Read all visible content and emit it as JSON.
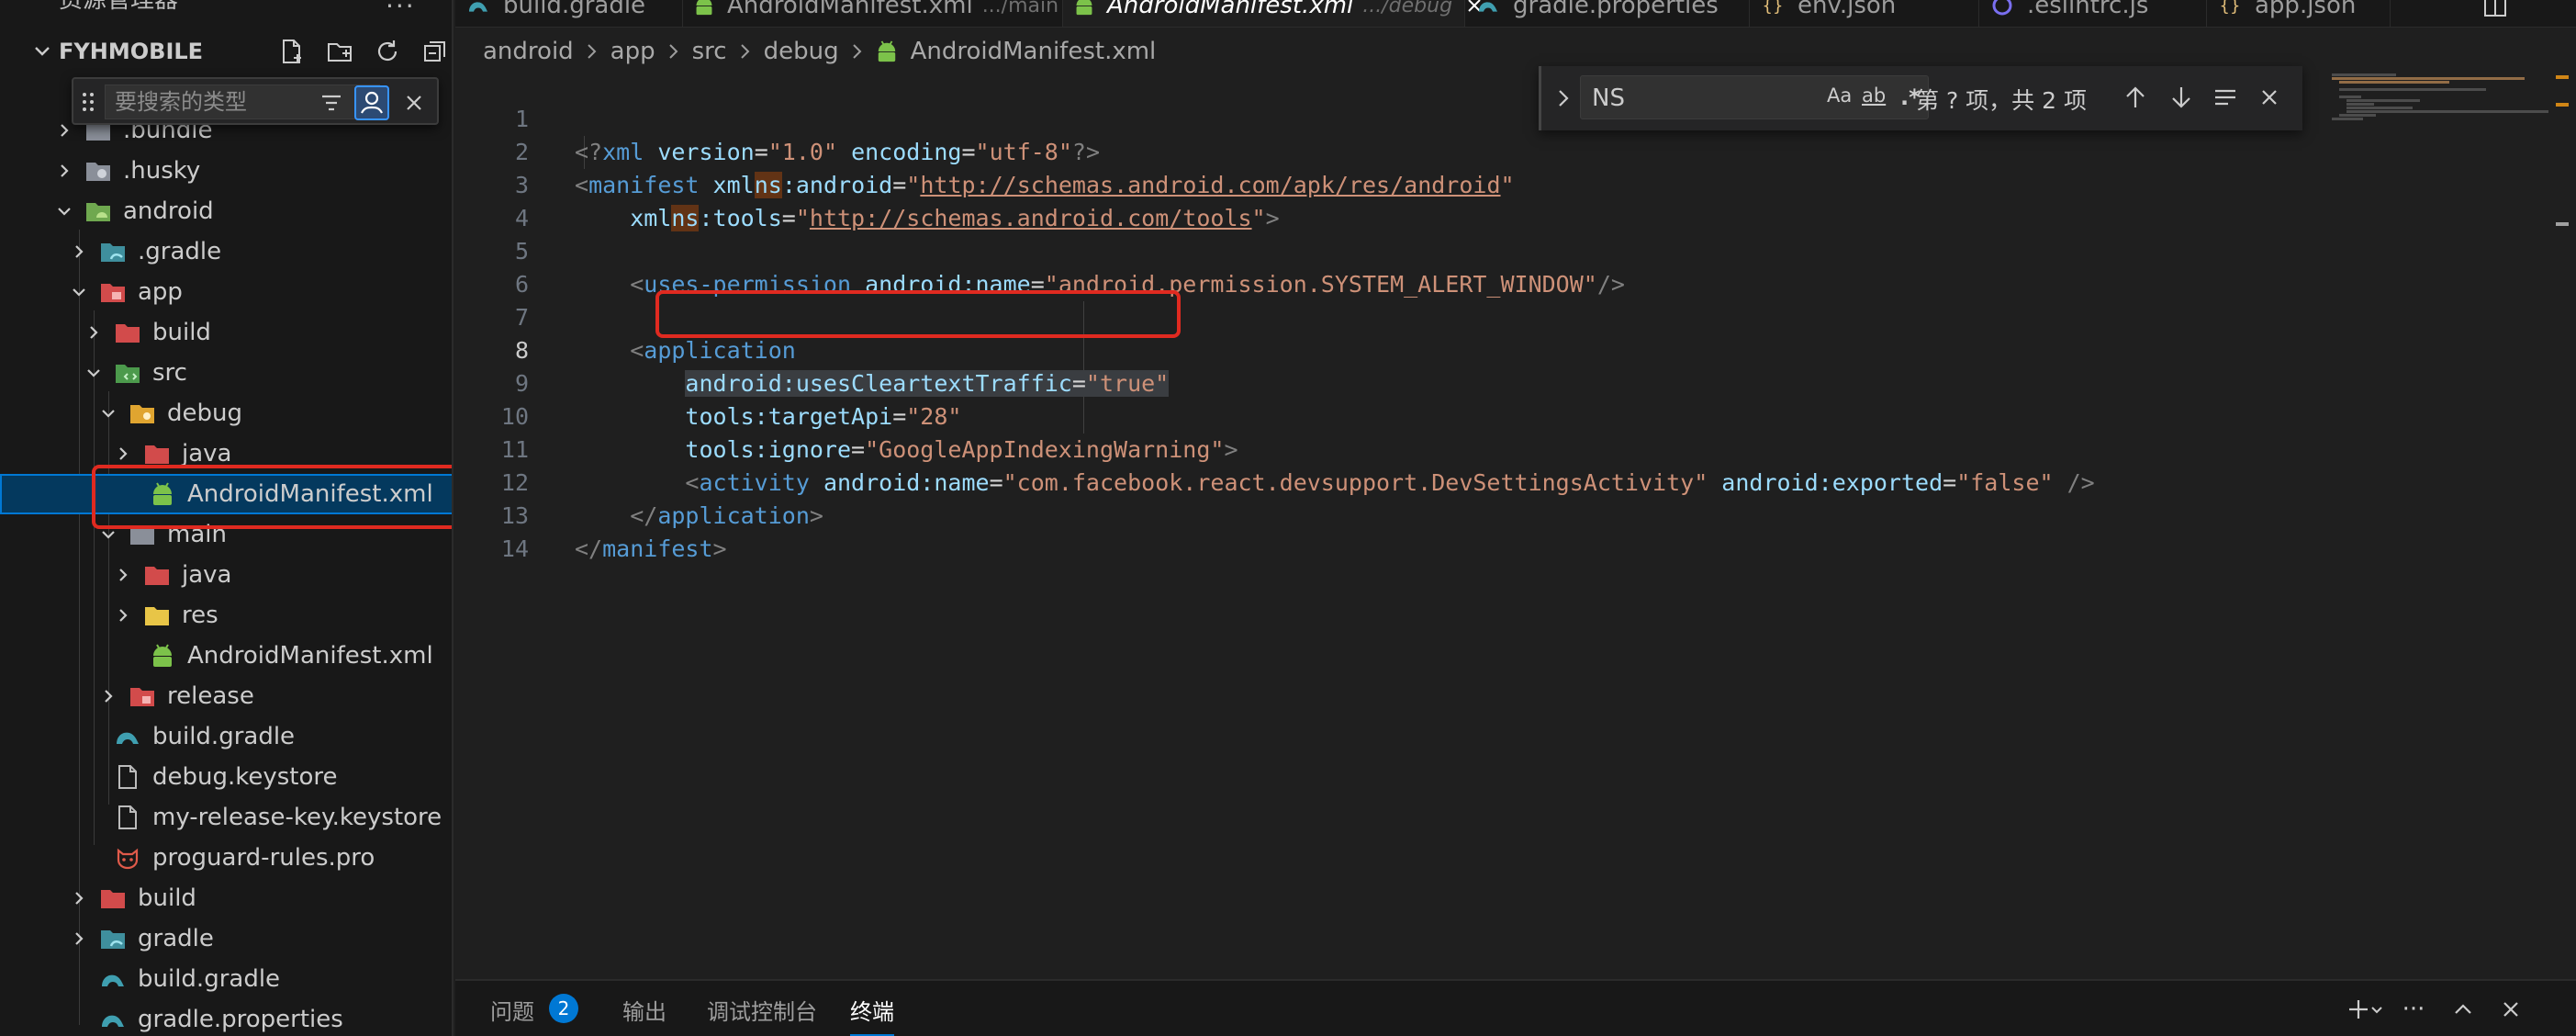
{
  "explorer": {
    "title": "资源管理器",
    "project": "FYHMOBILE",
    "filter_placeholder": "要搜索的类型",
    "items": [
      {
        "label": ".bundle"
      },
      {
        "label": ".husky"
      },
      {
        "label": "android"
      },
      {
        "label": ".gradle"
      },
      {
        "label": "app"
      },
      {
        "label": "build"
      },
      {
        "label": "src"
      },
      {
        "label": "debug"
      },
      {
        "label": "java"
      },
      {
        "label": "AndroidManifest.xml"
      },
      {
        "label": "main"
      },
      {
        "label": "java"
      },
      {
        "label": "res"
      },
      {
        "label": "AndroidManifest.xml"
      },
      {
        "label": "release"
      },
      {
        "label": "build.gradle"
      },
      {
        "label": "debug.keystore"
      },
      {
        "label": "my-release-key.keystore"
      },
      {
        "label": "proguard-rules.pro"
      },
      {
        "label": "build"
      },
      {
        "label": "gradle"
      },
      {
        "label": "build.gradle"
      },
      {
        "label": "gradle.properties"
      }
    ]
  },
  "tabs": [
    {
      "label": "build.gradle",
      "desc": ""
    },
    {
      "label": "AndroidManifest.xml",
      "desc": ".../main"
    },
    {
      "label": "AndroidManifest.xml",
      "desc": ".../debug"
    },
    {
      "label": "gradle.properties",
      "desc": ""
    },
    {
      "label": "env.json",
      "desc": ""
    },
    {
      "label": ".eslintrc.js",
      "desc": ""
    },
    {
      "label": "app.json",
      "desc": ""
    }
  ],
  "breadcrumb": [
    "android",
    "app",
    "src",
    "debug",
    "AndroidManifest.xml"
  ],
  "find": {
    "query": "NS",
    "opt_case": "Aa",
    "opt_word": "ab",
    "opt_regex": ".*",
    "result": "第 ? 项，共 2 项"
  },
  "code": {
    "l1": {
      "n": "1",
      "a": "<?",
      "b": "xml",
      "c": " version",
      "d": "=",
      "e": "\"1.0\"",
      "f": " encoding",
      "g": "=",
      "h": "\"utf-8\"",
      "i": "?>"
    },
    "l2": {
      "n": "2",
      "a": "<",
      "b": "manifest",
      "c": " xml",
      "d": "ns",
      "e": ":android",
      "f": "=",
      "g": "\"",
      "h": "http://schemas.android.com/apk/res/android",
      "i": "\""
    },
    "l3": {
      "n": "3",
      "a": "    xml",
      "b": "ns",
      "c": ":tools",
      "d": "=",
      "e": "\"",
      "f": "http://schemas.android.com/tools",
      "g": "\"",
      "h": ">"
    },
    "l4": {
      "n": "4"
    },
    "l5": {
      "n": "5",
      "a": "    <",
      "b": "uses-permission",
      "c": " android:name",
      "d": "=",
      "e": "\"android.permission.SYSTEM_ALERT_WINDOW\"",
      "f": "/>"
    },
    "l6": {
      "n": "6"
    },
    "l7": {
      "n": "7",
      "a": "    <",
      "b": "application"
    },
    "l8": {
      "n": "8",
      "a": "        ",
      "b": "android:usesCleartextTraffic",
      "c": "=",
      "d": "\"true\""
    },
    "l9": {
      "n": "9",
      "a": "        tools:targetApi",
      "b": "=",
      "c": "\"28\""
    },
    "l10": {
      "n": "10",
      "a": "        tools:ignore",
      "b": "=",
      "c": "\"GoogleAppIndexingWarning\"",
      "d": ">"
    },
    "l11": {
      "n": "11",
      "a": "        <",
      "b": "activity",
      "c": " android:name",
      "d": "=",
      "e": "\"com.facebook.react.devsupport.DevSettingsActivity\"",
      "f": " android:exported",
      "g": "=",
      "h": "\"false\"",
      "i": " />"
    },
    "l12": {
      "n": "12",
      "a": "    </",
      "b": "application",
      "c": ">"
    },
    "l13": {
      "n": "13",
      "a": "</",
      "b": "manifest",
      "c": ">"
    },
    "l14": {
      "n": "14"
    }
  },
  "panel": {
    "problems": "问题",
    "problems_count": "2",
    "output": "输出",
    "debug_console": "调试控制台",
    "terminal": "终端"
  },
  "colors": {
    "accent": "#0078d4",
    "highlight_box": "#e02a20",
    "xml_tag": "#569cd6",
    "xml_attr": "#9cdcfe",
    "xml_string": "#ce9178"
  }
}
